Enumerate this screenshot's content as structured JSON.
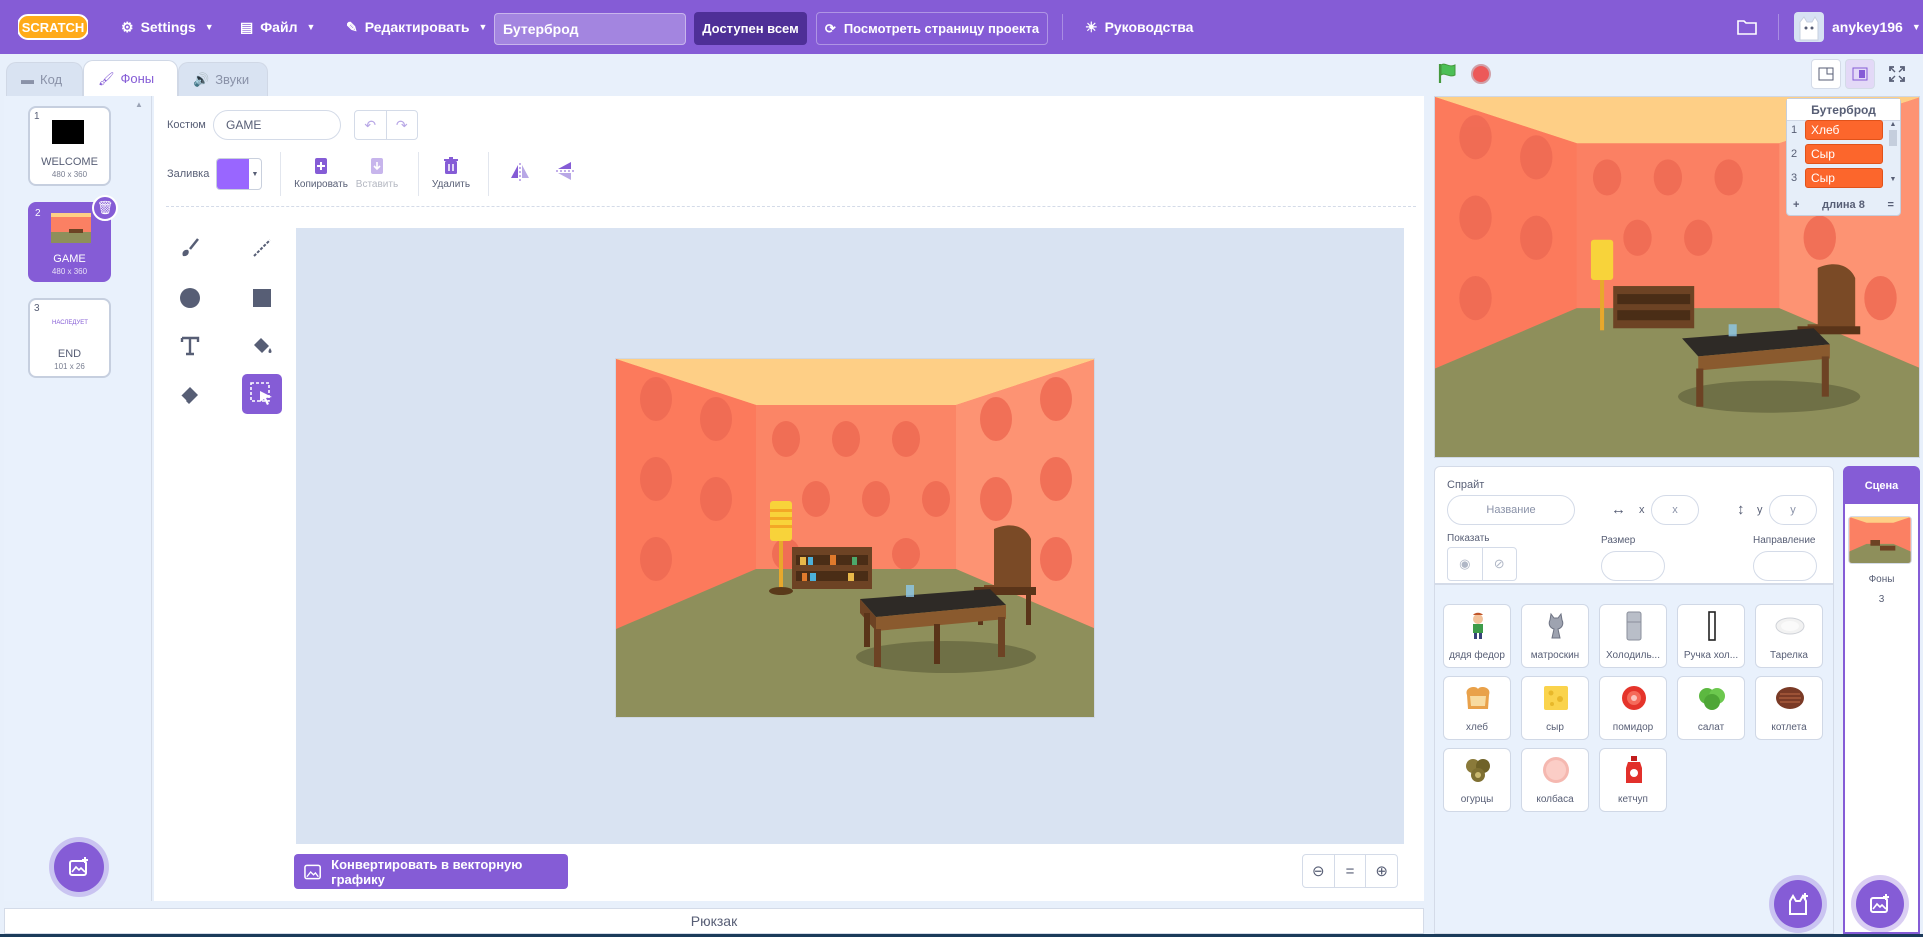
{
  "menu": {
    "logo": "Scratch",
    "settings": "Settings",
    "file": "Файл",
    "edit": "Редактировать",
    "project_title": "Бутерброд",
    "share": "Доступен всем",
    "see_project": "Посмотреть страницу проекта",
    "tutorials": "Руководства",
    "username": "anykey196"
  },
  "tabs": {
    "code": "Код",
    "backdrops": "Фоны",
    "sounds": "Звуки"
  },
  "costumes": [
    {
      "num": "1",
      "name": "WELCOME",
      "size": "480 x 360"
    },
    {
      "num": "2",
      "name": "GAME",
      "size": "480 x 360"
    },
    {
      "num": "3",
      "name": "END",
      "size": "101 x 26",
      "thumb_text": "НАСЛЕДУЕТ"
    }
  ],
  "editor": {
    "costume_label": "Костюм",
    "costume_name": "GAME",
    "fill_label": "Заливка",
    "fill_color": "#9966ff",
    "copy": "Копировать",
    "paste": "Вставить",
    "delete": "Удалить",
    "convert": "Конвертировать в векторную графику",
    "zoom_reset": "="
  },
  "backpack": "Рюкзак",
  "list_monitor": {
    "title": "Бутерброд",
    "items": [
      {
        "index": "1",
        "value": "Хлеб"
      },
      {
        "index": "2",
        "value": "Сыр"
      },
      {
        "index": "3",
        "value": "Сыр"
      }
    ],
    "add": "+",
    "length": "длина 8",
    "resize": "="
  },
  "sprite_info": {
    "sprite_label": "Спрайт",
    "name_placeholder": "Название",
    "x_label": "x",
    "x_placeholder": "x",
    "y_label": "y",
    "y_placeholder": "y",
    "show_label": "Показать",
    "size_label": "Размер",
    "direction_label": "Направление"
  },
  "sprites": [
    {
      "name": "дядя федор",
      "icon": "boy-icon"
    },
    {
      "name": "матроскин",
      "icon": "cat-icon"
    },
    {
      "name": "Холодиль...",
      "icon": "fridge-icon"
    },
    {
      "name": "Ручка хол...",
      "icon": "handle-icon"
    },
    {
      "name": "Тарелка",
      "icon": "plate-icon"
    },
    {
      "name": "хлеб",
      "icon": "bread-icon"
    },
    {
      "name": "сыр",
      "icon": "cheese-icon"
    },
    {
      "name": "помидор",
      "icon": "tomato-icon"
    },
    {
      "name": "салат",
      "icon": "lettuce-icon"
    },
    {
      "name": "котлета",
      "icon": "cutlet-icon"
    },
    {
      "name": "огурцы",
      "icon": "pickles-icon"
    },
    {
      "name": "колбаса",
      "icon": "sausage-icon"
    },
    {
      "name": "кетчуп",
      "icon": "ketchup-icon"
    }
  ],
  "stage_target": {
    "title": "Сцена",
    "backdrops_label": "Фоны",
    "backdrops_count": "3"
  },
  "colors": {
    "accent": "#855cd6",
    "list_item": "#fc662c",
    "stop": "#ec5959",
    "flag": "#4cbf56"
  }
}
